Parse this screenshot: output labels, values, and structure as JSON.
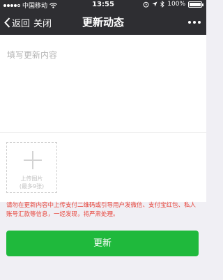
{
  "status_bar": {
    "carrier": "中国移动",
    "time": "13:55",
    "battery_percent": "100%",
    "signal_bars": 4
  },
  "nav": {
    "back_label": "返回",
    "close_label": "关闭",
    "title": "更新动态"
  },
  "compose": {
    "placeholder": "填写更新内容"
  },
  "upload": {
    "label": "上传图片",
    "limit": "(最多9张)"
  },
  "warning": "请勿在更新内容中上传支付二维码或引导用户发微信、支付宝红包、私人账号汇款等信息，一经发现，将严肃处理。",
  "submit_label": "更新",
  "colors": {
    "header_bg": "#2e2e32",
    "accent_green": "#1fb93c",
    "warning_red": "#e8443a",
    "page_bg": "#f0eff4"
  }
}
